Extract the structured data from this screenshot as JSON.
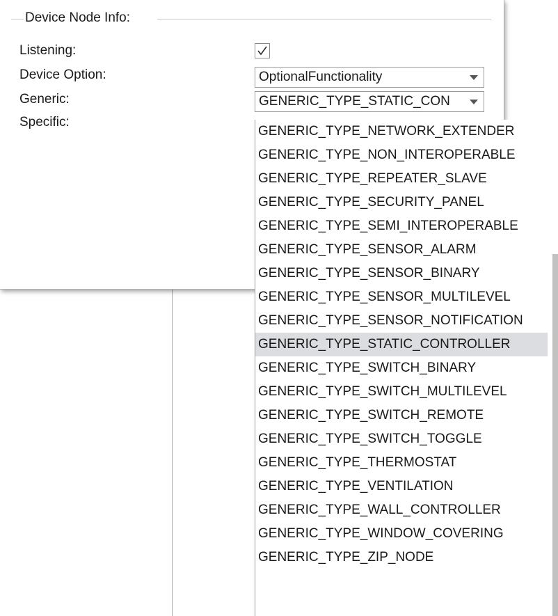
{
  "group": {
    "title": "Device Node Info:"
  },
  "fields": {
    "listening_label": "Listening:",
    "device_option_label": "Device Option:",
    "generic_label": "Generic:",
    "specific_label": "Specific:"
  },
  "listening": {
    "checked": true
  },
  "device_option": {
    "value": "OptionalFunctionality"
  },
  "generic": {
    "value": "GENERIC_TYPE_STATIC_CON",
    "options": [
      "GENERIC_TYPE_NETWORK_EXTENDER",
      "GENERIC_TYPE_NON_INTEROPERABLE",
      "GENERIC_TYPE_REPEATER_SLAVE",
      "GENERIC_TYPE_SECURITY_PANEL",
      "GENERIC_TYPE_SEMI_INTEROPERABLE",
      "GENERIC_TYPE_SENSOR_ALARM",
      "GENERIC_TYPE_SENSOR_BINARY",
      "GENERIC_TYPE_SENSOR_MULTILEVEL",
      "GENERIC_TYPE_SENSOR_NOTIFICATION",
      "GENERIC_TYPE_STATIC_CONTROLLER",
      "GENERIC_TYPE_SWITCH_BINARY",
      "GENERIC_TYPE_SWITCH_MULTILEVEL",
      "GENERIC_TYPE_SWITCH_REMOTE",
      "GENERIC_TYPE_SWITCH_TOGGLE",
      "GENERIC_TYPE_THERMOSTAT",
      "GENERIC_TYPE_VENTILATION",
      "GENERIC_TYPE_WALL_CONTROLLER",
      "GENERIC_TYPE_WINDOW_COVERING",
      "GENERIC_TYPE_ZIP_NODE"
    ],
    "selected_index": 9
  },
  "icons": {
    "checkmark": "check-icon",
    "dropdown_arrow": "chevron-down-icon"
  },
  "colors": {
    "selected_bg": "#dcdde0",
    "scrollbar": "#c2c2c2"
  }
}
